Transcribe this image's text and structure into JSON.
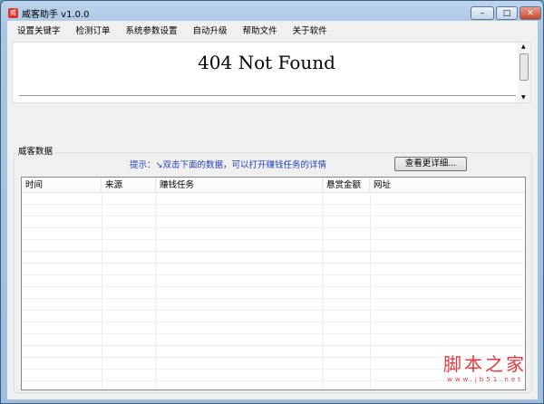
{
  "window": {
    "title": "威客助手 v1.0.0",
    "logo_char": "威",
    "minimize": "–",
    "maximize": "□",
    "close": "✕"
  },
  "menu": [
    "设置关键字",
    "检测订单",
    "系统参数设置",
    "自动升级",
    "帮助文件",
    "关于软件"
  ],
  "browser": {
    "heading": "404 Not Found"
  },
  "group": {
    "label": "威客数据",
    "hint": "提示：↘双击下面的数据，可以打开赚钱任务的详情",
    "detail_button": "查看更详细..."
  },
  "table": {
    "columns": [
      "时间",
      "来源",
      "赚钱任务",
      "悬赏金额",
      "网址"
    ]
  },
  "watermark": {
    "line1": "脚本之家",
    "line2": "www.jb51.net"
  }
}
